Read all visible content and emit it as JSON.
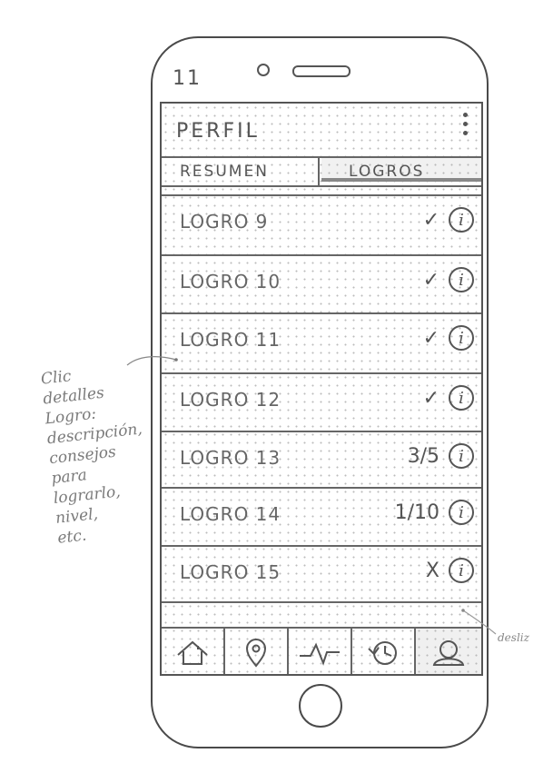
{
  "status_bar": {
    "time": "11"
  },
  "header": {
    "title": "PERFIL",
    "menu_icon": "more-vertical-icon"
  },
  "tabs": [
    {
      "label": "RESUMEN",
      "selected": false
    },
    {
      "label": "LOGROS",
      "selected": true
    }
  ],
  "achievements": [
    {
      "label": "LOGRO 9",
      "status": "✓"
    },
    {
      "label": "LOGRO 10",
      "status": "✓"
    },
    {
      "label": "LOGRO 11",
      "status": "✓"
    },
    {
      "label": "LOGRO 12",
      "status": "✓"
    },
    {
      "label": "LOGRO 13",
      "status": "3/5"
    },
    {
      "label": "LOGRO 14",
      "status": "1/10"
    },
    {
      "label": "LOGRO 15",
      "status": "X"
    }
  ],
  "info_icon_glyph": "i",
  "bottom_nav": [
    {
      "icon": "home-icon"
    },
    {
      "icon": "location-pin-icon"
    },
    {
      "icon": "activity-pulse-icon"
    },
    {
      "icon": "history-clock-icon"
    },
    {
      "icon": "profile-icon",
      "selected": true
    }
  ],
  "annotations": {
    "left_note_lines": [
      "Clic",
      "detalles",
      "Logro:",
      "descripción,",
      "consejos",
      "para",
      "lograrlo,",
      "nivel,",
      "etc."
    ],
    "right_note": "desliz"
  }
}
